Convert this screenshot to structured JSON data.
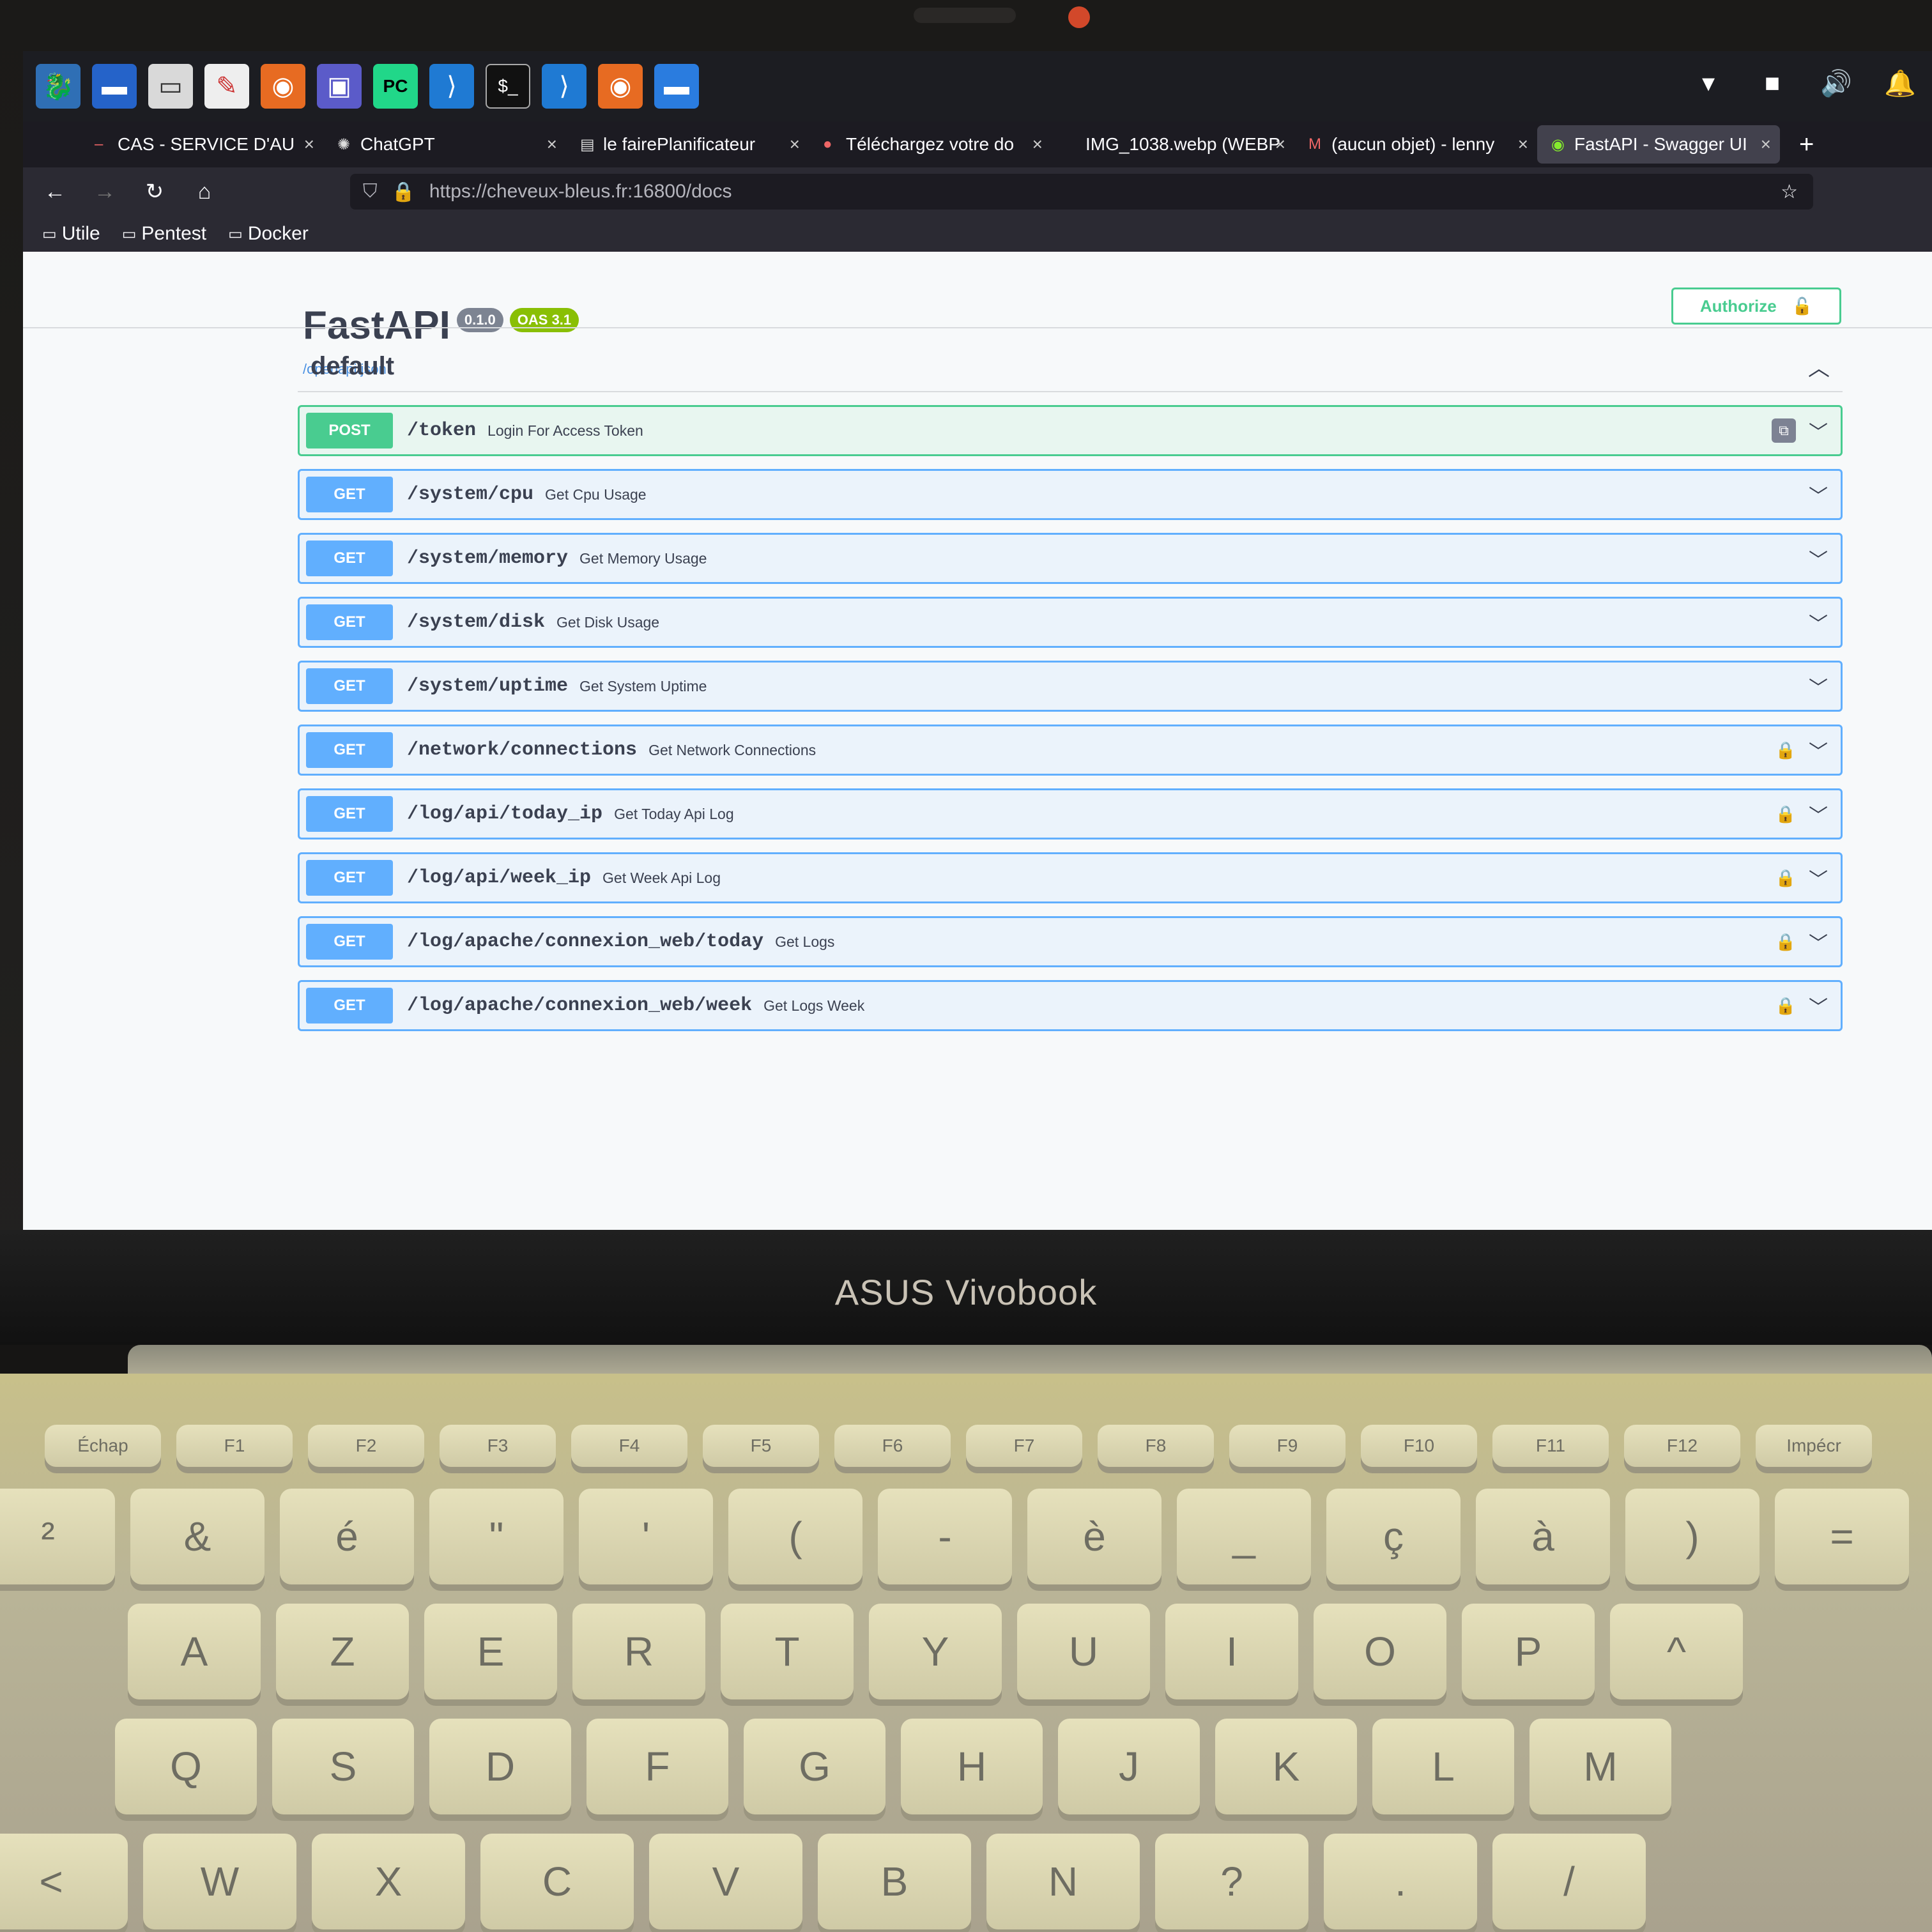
{
  "tabs": [
    {
      "label": "CAS - SERVICE D'AU",
      "icon": "cas-icon"
    },
    {
      "label": "ChatGPT",
      "icon": "openai-icon"
    },
    {
      "label": "le fairePlanificateur",
      "icon": "doc-icon"
    },
    {
      "label": "Téléchargez votre do",
      "icon": "download-icon"
    },
    {
      "label": "IMG_1038.webp (WEBP",
      "icon": "image-icon"
    },
    {
      "label": "(aucun objet) - lenny",
      "icon": "gmail-icon"
    },
    {
      "label": "FastAPI - Swagger UI",
      "icon": "swagger-icon"
    }
  ],
  "url": "https://cheveux-bleus.fr:16800/docs",
  "bookmarks": [
    "Utile",
    "Pentest",
    "Docker"
  ],
  "api": {
    "title": "FastAPI",
    "version": "0.1.0",
    "oas": "OAS 3.1",
    "openapi_link": "/openapi.json",
    "authorize_label": "Authorize",
    "section": "default"
  },
  "operations": [
    {
      "method": "POST",
      "path": "/token",
      "summary": "Login For Access Token",
      "locked": false
    },
    {
      "method": "GET",
      "path": "/system/cpu",
      "summary": "Get Cpu Usage",
      "locked": false
    },
    {
      "method": "GET",
      "path": "/system/memory",
      "summary": "Get Memory Usage",
      "locked": false
    },
    {
      "method": "GET",
      "path": "/system/disk",
      "summary": "Get Disk Usage",
      "locked": false
    },
    {
      "method": "GET",
      "path": "/system/uptime",
      "summary": "Get System Uptime",
      "locked": false
    },
    {
      "method": "GET",
      "path": "/network/connections",
      "summary": "Get Network Connections",
      "locked": true
    },
    {
      "method": "GET",
      "path": "/log/api/today_ip",
      "summary": "Get Today Api Log",
      "locked": true
    },
    {
      "method": "GET",
      "path": "/log/api/week_ip",
      "summary": "Get Week Api Log",
      "locked": true
    },
    {
      "method": "GET",
      "path": "/log/apache/connexion_web/today",
      "summary": "Get Logs",
      "locked": true
    },
    {
      "method": "GET",
      "path": "/log/apache/connexion_web/week",
      "summary": "Get Logs Week",
      "locked": true
    }
  ],
  "laptop_brand": "ASUS Vivobook",
  "keys": {
    "frow": [
      "Échap",
      "F1",
      "F2",
      "F3",
      "F4",
      "F5",
      "F6",
      "F7",
      "F8",
      "F9",
      "F10",
      "F11",
      "F12",
      "Impécr"
    ],
    "num": [
      "²",
      "&",
      "é",
      "\"",
      "'",
      "(",
      "-",
      "è",
      "_",
      "ç",
      "à",
      ")",
      "="
    ],
    "row1": [
      "A",
      "Z",
      "E",
      "R",
      "T",
      "Y",
      "U",
      "I",
      "O",
      "P",
      "^"
    ],
    "row2": [
      "Q",
      "S",
      "D",
      "F",
      "G",
      "H",
      "J",
      "K",
      "L",
      "M"
    ],
    "row3": [
      "<",
      "W",
      "X",
      "C",
      "V",
      "B",
      "N",
      "?",
      ".",
      "/"
    ]
  },
  "colors": {
    "get": "#61affe",
    "post": "#49cc90",
    "oas_badge": "#89bf04"
  }
}
